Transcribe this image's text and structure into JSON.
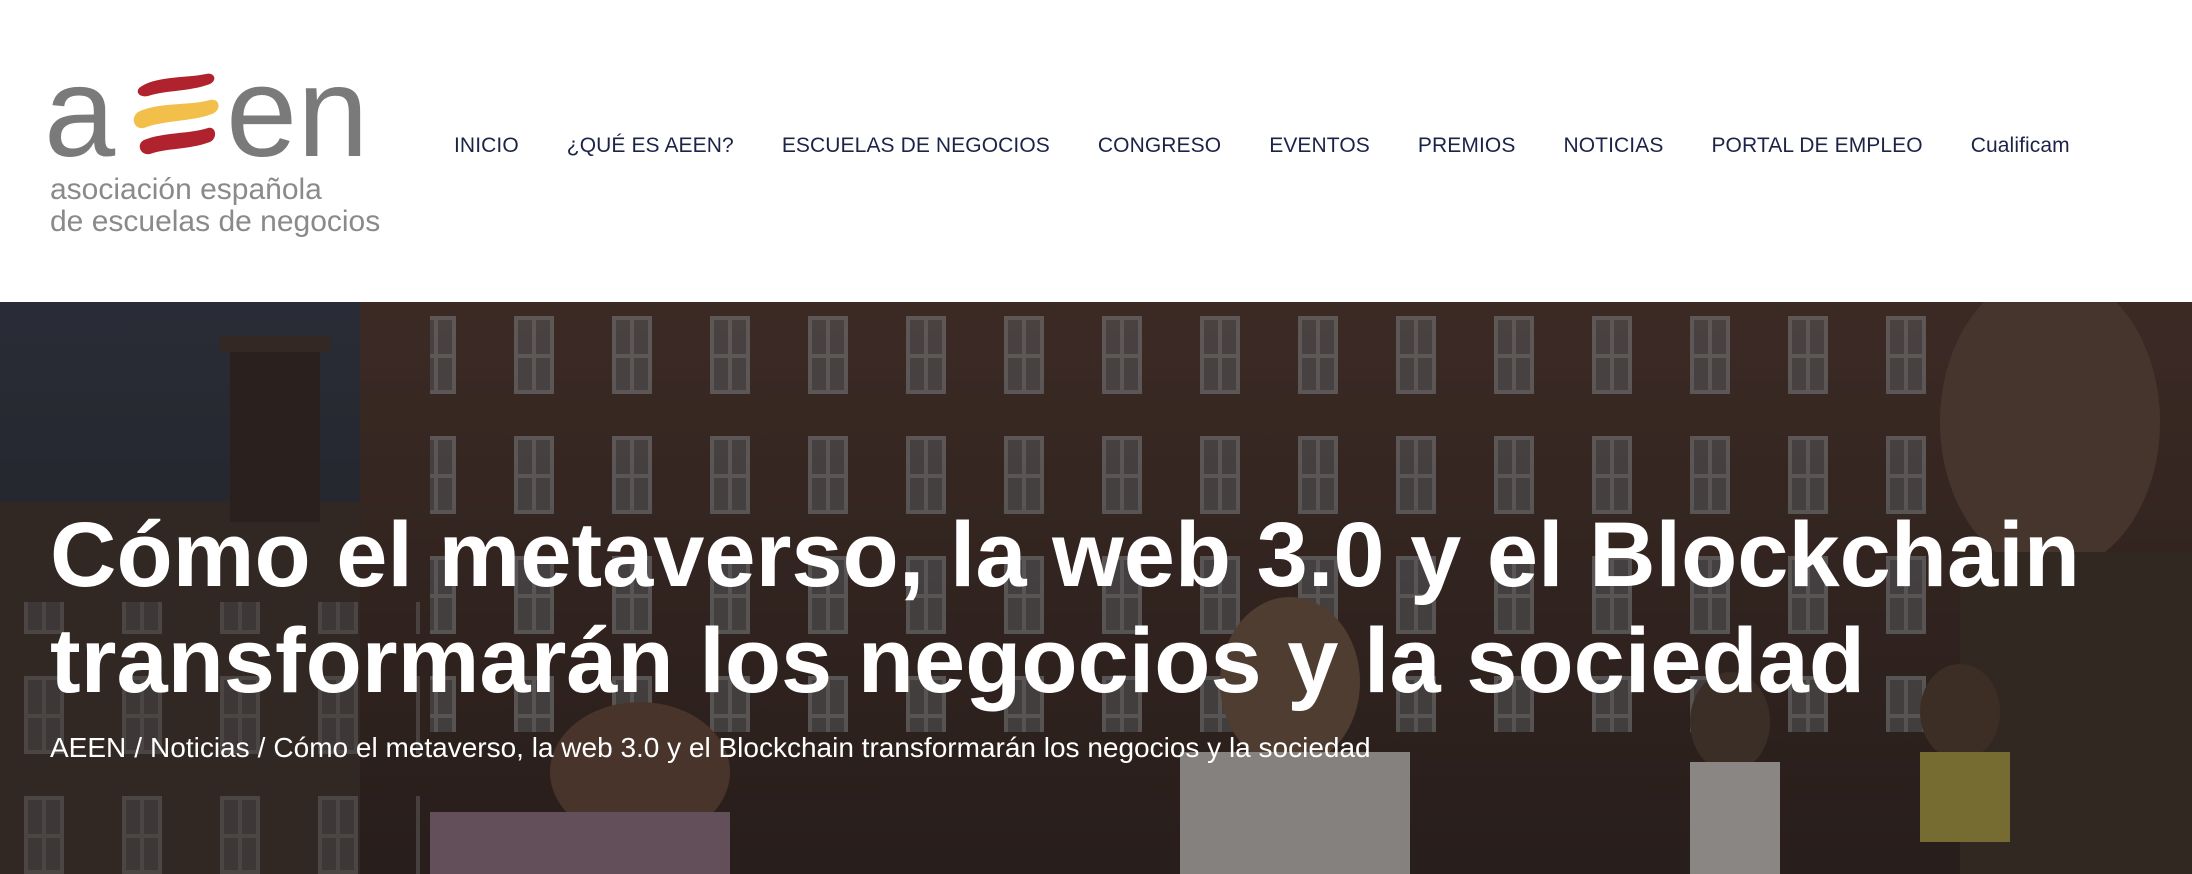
{
  "logo": {
    "wordmark_left": "a",
    "wordmark_right": "en",
    "line1": "asociación española",
    "line2": "de escuelas de negocios",
    "colors": {
      "gray": "#7a7a7a",
      "red": "#b0222e",
      "yellow": "#f2c04a"
    }
  },
  "nav": {
    "items": [
      {
        "label": "INICIO"
      },
      {
        "label": "¿QUÉ ES AEEN?"
      },
      {
        "label": "ESCUELAS DE NEGOCIOS"
      },
      {
        "label": "CONGRESO"
      },
      {
        "label": "EVENTOS"
      },
      {
        "label": "PREMIOS"
      },
      {
        "label": "NOTICIAS"
      },
      {
        "label": "PORTAL DE EMPLEO"
      },
      {
        "label": "Cualificam"
      }
    ],
    "color": "#1b2347"
  },
  "hero": {
    "title_line1": "Cómo el metaverso, la web 3.0 y el Blockchain",
    "title_line2": "transformarán los negocios y la sociedad",
    "breadcrumb": {
      "home": "AEEN",
      "section": "Noticias",
      "current": "Cómo el metaverso, la web 3.0 y el Blockchain transformarán los negocios y la sociedad",
      "separator": "/"
    }
  }
}
